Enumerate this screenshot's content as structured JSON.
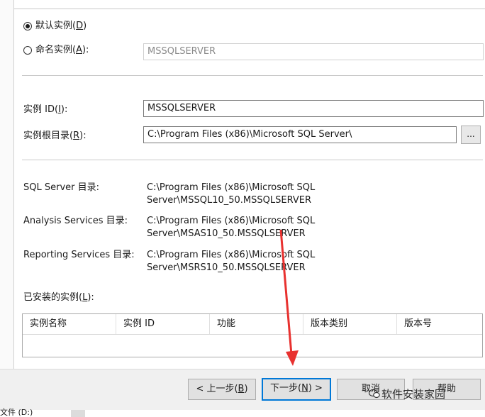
{
  "instance": {
    "default_label": "默认实例(",
    "default_key": "D",
    "named_label": "命名实例(",
    "named_key": "A",
    "named_value": "MSSQLSERVER"
  },
  "fields": {
    "id_label": "实例 ID(",
    "id_key": "I",
    "id_value": "MSSQLSERVER",
    "root_label": "实例根目录(",
    "root_key": "R",
    "root_value": "C:\\Program Files (x86)\\Microsoft SQL Server\\",
    "browse_label": "..."
  },
  "dirs": [
    {
      "label": "SQL Server 目录:",
      "line1": "C:\\Program Files (x86)\\Microsoft SQL",
      "line2": "Server\\MSSQL10_50.MSSQLSERVER"
    },
    {
      "label": "Analysis Services 目录:",
      "line1": "C:\\Program Files (x86)\\Microsoft SQL",
      "line2": "Server\\MSAS10_50.MSSQLSERVER"
    },
    {
      "label": "Reporting Services 目录:",
      "line1": "C:\\Program Files (x86)\\Microsoft SQL",
      "line2": "Server\\MSRS10_50.MSSQLSERVER"
    }
  ],
  "installed": {
    "label": "已安装的实例(",
    "key": "L",
    "columns": [
      "实例名称",
      "实例 ID",
      "功能",
      "版本类别",
      "版本号"
    ]
  },
  "buttons": {
    "back_pre": "< 上一步(",
    "back_key": "B",
    "next_pre": "下一步(",
    "next_key": "N",
    "next_post": ") >",
    "cancel": "取消",
    "help": "帮助"
  },
  "watermark": "软件安装家园",
  "bottom_text": "文件 (D:)",
  "colors": {
    "arrow": "#e8312f",
    "default_button_border": "#0078d7"
  }
}
